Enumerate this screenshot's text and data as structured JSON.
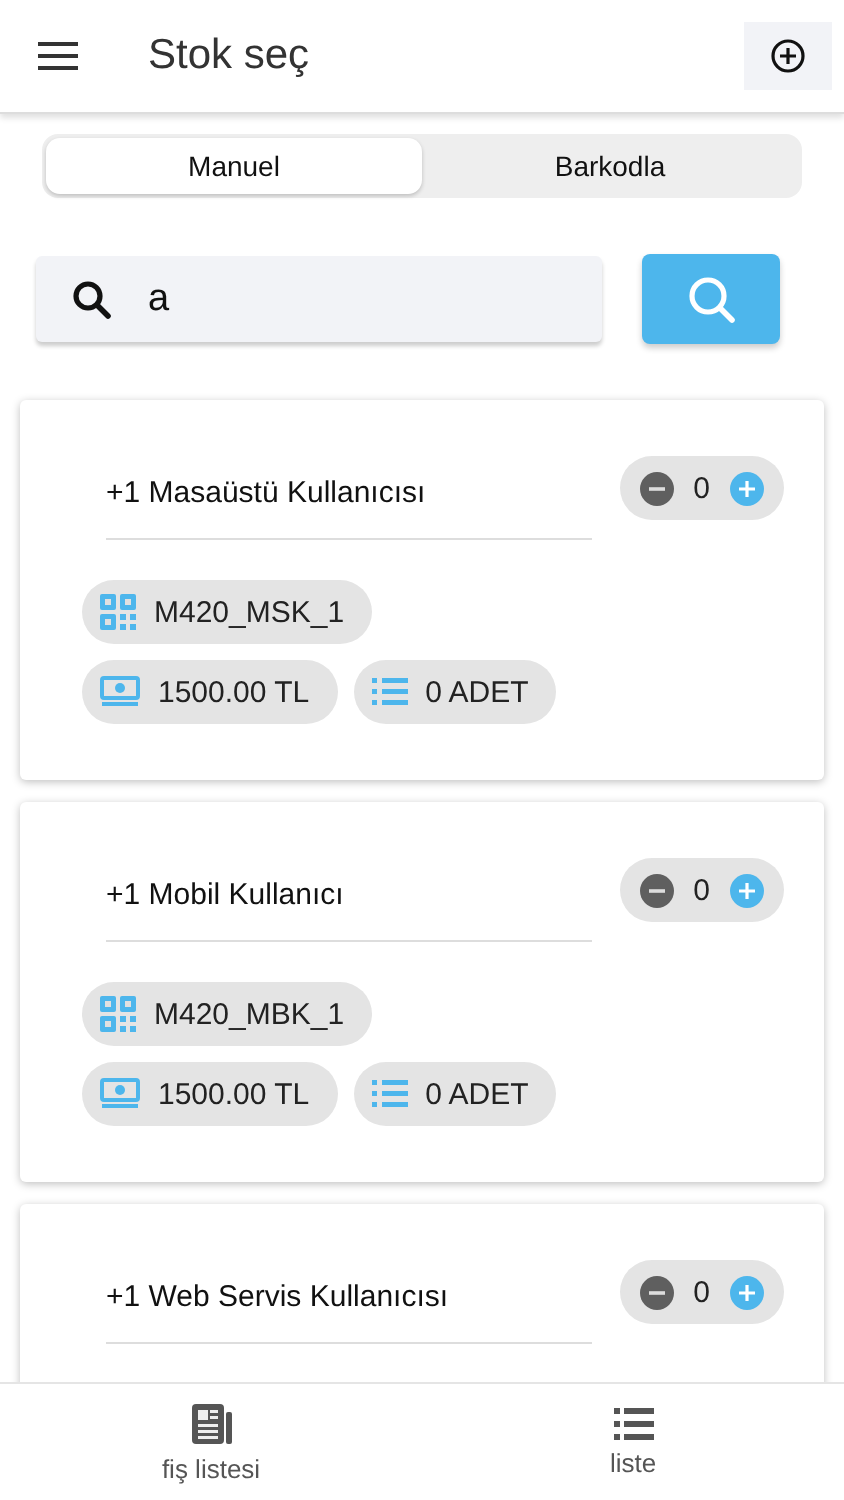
{
  "header": {
    "title": "Stok seç"
  },
  "tabs": [
    {
      "label": "Manuel",
      "selected": true
    },
    {
      "label": "Barkodla",
      "selected": false
    }
  ],
  "search": {
    "value": "a"
  },
  "items": [
    {
      "name": "+1 Masaüstü Kullanıcısı",
      "quantity": "0",
      "code": "M420_MSK_1",
      "price": "1500.00 TL",
      "amount": "0 ADET"
    },
    {
      "name": "+1 Mobil Kullanıcı",
      "quantity": "0",
      "code": "M420_MBK_1",
      "price": "1500.00 TL",
      "amount": "0 ADET"
    },
    {
      "name": "+1 Web Servis Kullanıcısı",
      "quantity": "0"
    }
  ],
  "bottom_nav": [
    {
      "label": "fiş listesi",
      "kind": "receipts"
    },
    {
      "label": "liste",
      "kind": "list"
    }
  ]
}
